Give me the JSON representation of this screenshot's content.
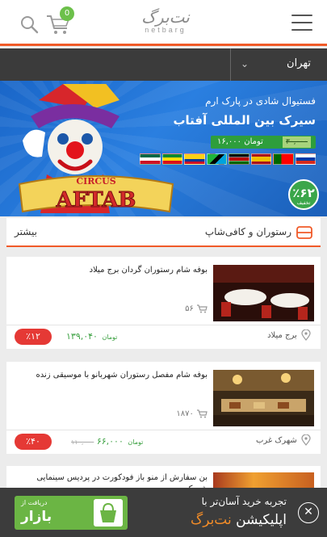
{
  "header": {
    "logo_mark": "نت‌برگ",
    "logo_sub": "netbarg",
    "cart_count": "0",
    "icons": {
      "menu": "hamburger-icon",
      "search": "search-icon",
      "cart": "cart-icon"
    }
  },
  "city": {
    "label": "تهران",
    "chevron": "⌄"
  },
  "banner": {
    "subtitle": "فستیوال شادی در پارک ارم",
    "title": "سیرک بین المللی آفتاب",
    "old_price": "۳۰,۰۰۰",
    "new_price": "۱۶,۰۰۰ تومان",
    "circus_small": "CIRCUS",
    "circus_big": "AFTAB",
    "discount": "٪۶۲",
    "discount_caption": "تخفیف"
  },
  "section": {
    "title": "رستوران و کافی‌شاپ",
    "more": "بیشتر"
  },
  "cards": [
    {
      "title": "بوفه شام رستوران گردان برج میلاد",
      "count": "۵۶",
      "location": "برج میلاد",
      "price": "۱۳۹,۰۴۰",
      "unit": "تومان",
      "old_price": "",
      "discount": "٪۱۲"
    },
    {
      "title": "بوفه شام مفصل رستوران شهربانو با موسیقی زنده",
      "count": "۱۸۷۰",
      "location": "شهرک غرب",
      "price": "۶۶,۰۰۰",
      "unit": "تومان",
      "old_price": "۱۱۰,۰۰۰",
      "discount": "٪۴۰"
    },
    {
      "title": "بن سفارش از منو باز فودکورت در پردیس سینمایی شهرک"
    }
  ],
  "appbar": {
    "line1": "تجربه خرید آسان‌تر با",
    "line2_prefix": "اپلیکیشن",
    "line2_brand": "نت‌برگ",
    "close": "✕",
    "bazaar_get": "دریافت از",
    "bazaar_name": "بازار"
  },
  "colors": {
    "accent": "#f05a28",
    "green": "#3aa040",
    "red": "#e53935",
    "dark": "#3c3c3c"
  }
}
